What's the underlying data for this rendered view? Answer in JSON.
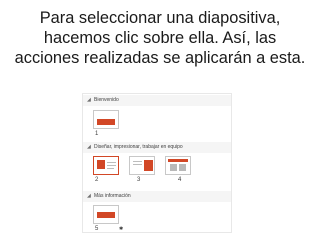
{
  "caption": {
    "line1": "Para seleccionar una diapositiva,",
    "line2": "hacemos clic sobre ella. Así, las",
    "line3": "acciones realizadas se aplicarán a esta."
  },
  "sections": [
    {
      "title": "Bienvenido",
      "slides": [
        "1"
      ]
    },
    {
      "title": "Diseñar, impresionar, trabajar en equipo",
      "slides": [
        "2",
        "3",
        "4"
      ]
    },
    {
      "title": "Más información",
      "slides": [
        "5"
      ]
    }
  ],
  "colors": {
    "accent": "#d24726",
    "selected_border": "#d24726",
    "header_bg": "#f5f5f5"
  },
  "icons": {
    "section_toggle": "caret-icon",
    "slide_transition": "star-icon"
  }
}
